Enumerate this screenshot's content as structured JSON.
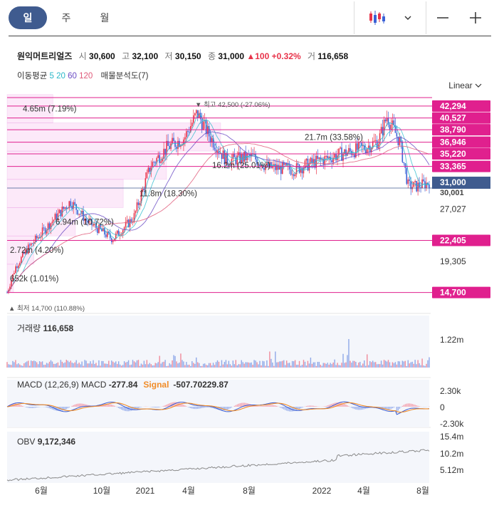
{
  "tabs": [
    {
      "label": "일"
    },
    {
      "label": "주"
    },
    {
      "label": "월"
    }
  ],
  "toolbar": {
    "minus": "—",
    "plus": "+"
  },
  "stock": {
    "name": "원익머트리얼즈",
    "open_label": "시",
    "open": "30,600",
    "high_label": "고",
    "high": "32,100",
    "low_label": "저",
    "low": "30,150",
    "close_label": "종",
    "close": "31,000",
    "change": "▲100",
    "change_pct": "+0.32%",
    "volume_label": "거",
    "volume": "116,658"
  },
  "ma": {
    "label": "이동평균",
    "periods": [
      "5",
      "20",
      "60",
      "120"
    ],
    "period_colors": [
      "#2ab7c9",
      "#2ab7c9",
      "#6a4bc4",
      "#e05a7a"
    ],
    "volume_profile": "매물분석도(7)"
  },
  "scale_mode": "Linear",
  "colors": {
    "up": "#e8334a",
    "down": "#3b62d6",
    "magenta": "#e0208e",
    "band": "rgba(236,120,220,0.16)",
    "accent": "#3f5b8f"
  },
  "chart_data": [
    {
      "type": "candlestick",
      "y_axis_ticks": [
        27027,
        19305
      ],
      "y_range": [
        13500,
        44500
      ],
      "price_levels": [
        42294,
        40527,
        38790,
        36946,
        35220,
        33365,
        22405,
        14700
      ],
      "current_price": 31000,
      "current_price_label": "31,000",
      "below_current_label": "30,001",
      "hidden_tick_labels": [
        "44,000",
        "23,166",
        "15,444"
      ],
      "x_labels": [
        "6월",
        "10월",
        "2021",
        "4월",
        "8월",
        "2022",
        "4월",
        "8월"
      ],
      "high_marker": {
        "label": "최고",
        "value": "42,500",
        "pct": "(-27.06%)"
      },
      "low_marker": {
        "label": "최저",
        "value": "14,700",
        "pct": "(110.88%)"
      },
      "volume_profile": [
        {
          "label": "652k (1.01%)",
          "value": 652000
        },
        {
          "label": "2.72m (4.20%)",
          "value": 2720000
        },
        {
          "label": "6.94m (10.72%)",
          "value": 6940000
        },
        {
          "label": "11.8m (18.30%)",
          "value": 11800000
        },
        {
          "label": "16.2m (25.01%)",
          "value": 16200000
        },
        {
          "label": "21.7m (33.58%)",
          "value": 21700000
        },
        {
          "label": "4.65m (7.19%)",
          "value": 4650000
        }
      ],
      "price_trend": [
        [
          0,
          14700
        ],
        [
          0.02,
          18500
        ],
        [
          0.05,
          21300
        ],
        [
          0.1,
          24800
        ],
        [
          0.15,
          28200
        ],
        [
          0.19,
          25200
        ],
        [
          0.25,
          22600
        ],
        [
          0.3,
          25800
        ],
        [
          0.34,
          33500
        ],
        [
          0.38,
          36200
        ],
        [
          0.42,
          37600
        ],
        [
          0.45,
          41300
        ],
        [
          0.48,
          37800
        ],
        [
          0.52,
          34200
        ],
        [
          0.58,
          34800
        ],
        [
          0.62,
          33200
        ],
        [
          0.68,
          32900
        ],
        [
          0.72,
          33800
        ],
        [
          0.78,
          35000
        ],
        [
          0.85,
          36200
        ],
        [
          0.88,
          37200
        ],
        [
          0.9,
          40800
        ],
        [
          0.93,
          37000
        ],
        [
          0.95,
          30500
        ],
        [
          0.97,
          30400
        ],
        [
          1.0,
          31000
        ]
      ]
    },
    {
      "type": "bar",
      "title": "거래량",
      "value": "116,658",
      "y_axis_ticks": [
        "1.22m"
      ]
    },
    {
      "type": "line",
      "title": "MACD (12,26,9)",
      "series": [
        {
          "name": "MACD",
          "value": "-277.84"
        },
        {
          "name": "Signal",
          "value": "-507.70229.87"
        }
      ],
      "y_axis_ticks": [
        "2.30k",
        "0",
        "-2.30k"
      ]
    },
    {
      "type": "line",
      "title": "OBV",
      "value": "9,172,346",
      "y_axis_ticks": [
        "15.4m",
        "10.2m",
        "5.12m"
      ]
    }
  ]
}
